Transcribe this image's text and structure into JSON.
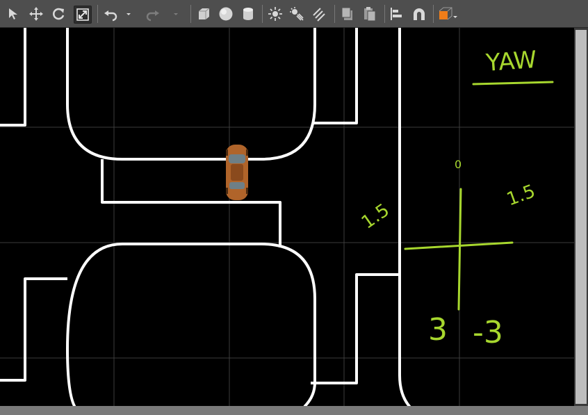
{
  "toolbar": {
    "tools": [
      {
        "name": "select-tool-button",
        "icon": "cursor-arrow-icon"
      },
      {
        "name": "translate-tool-button",
        "icon": "move-cross-icon"
      },
      {
        "name": "rotate-tool-button",
        "icon": "rotate-icon"
      },
      {
        "name": "scale-tool-button",
        "icon": "scale-icon",
        "active": true
      },
      {
        "name": "undo-button",
        "icon": "undo-icon"
      },
      {
        "name": "undo-dropdown-button",
        "icon": "chevron-down-icon"
      },
      {
        "name": "redo-button",
        "icon": "redo-icon"
      },
      {
        "name": "redo-dropdown-button",
        "icon": "chevron-down-icon"
      },
      {
        "name": "insert-box-button",
        "icon": "box-icon"
      },
      {
        "name": "insert-sphere-button",
        "icon": "sphere-icon"
      },
      {
        "name": "insert-cylinder-button",
        "icon": "cylinder-icon"
      },
      {
        "name": "point-light-button",
        "icon": "sun-icon"
      },
      {
        "name": "spot-light-button",
        "icon": "spotlight-icon"
      },
      {
        "name": "directional-light-button",
        "icon": "directional-light-icon"
      },
      {
        "name": "copy-button",
        "icon": "copy-icon"
      },
      {
        "name": "paste-button",
        "icon": "paste-icon"
      },
      {
        "name": "align-button",
        "icon": "align-icon"
      },
      {
        "name": "snap-button",
        "icon": "magnet-icon"
      },
      {
        "name": "view-angle-button",
        "icon": "view-cube-icon"
      }
    ]
  },
  "colors": {
    "toolbar_bg": "#4e4e4e",
    "viewport_bg": "#000000",
    "grid_line": "#3d3d3d",
    "road_line": "#ffffff",
    "annotation": "#a7d72e",
    "car_body": "#b0642a",
    "accent_orange": "#f07d19"
  },
  "annotations": {
    "title": "YAW",
    "axis_top": "0",
    "upper_left": "1.5",
    "upper_right": "1.5",
    "lower_left": "3",
    "lower_right": "-3"
  },
  "scene": {
    "car": {
      "icon": "car-model-icon"
    }
  }
}
